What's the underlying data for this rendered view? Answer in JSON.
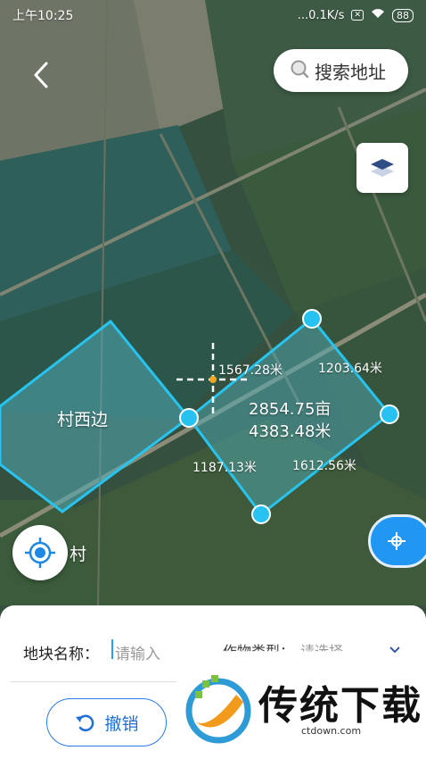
{
  "status_bar": {
    "time": "上午10:25",
    "network_speed": "...0.1K/s",
    "battery": "88"
  },
  "search": {
    "label": "搜索地址"
  },
  "map": {
    "village_label": "村",
    "plot_saved": {
      "name": "村西边"
    },
    "plot_current": {
      "area": "2854.75亩",
      "perimeter": "4383.48米",
      "edges": [
        "1567.28米",
        "1203.64米",
        "1187.13米",
        "1612.56米"
      ]
    }
  },
  "form": {
    "plot_name_label": "地块名称：",
    "plot_name_placeholder": "请输入",
    "crop_type_label": "作物类型：",
    "crop_type_placeholder": "请选择",
    "undo_label": "撤销"
  },
  "watermark": {
    "text": "传统下载",
    "url": "ctdown.com"
  },
  "colors": {
    "accent": "#2196f3",
    "outline": "#27c4f0",
    "fill": "#3f8f9a"
  },
  "icons": [
    "back-icon",
    "search-icon",
    "layers-icon",
    "locate-icon",
    "edit-tool-icon",
    "undo-icon",
    "chevron-down-icon"
  ]
}
